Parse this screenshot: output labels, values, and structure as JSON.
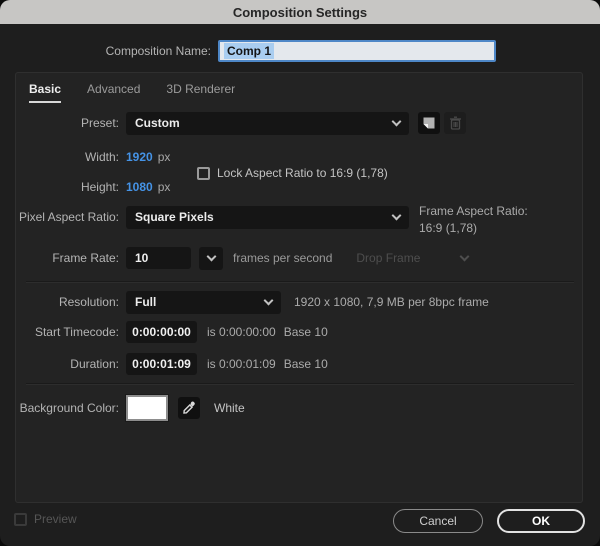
{
  "titlebar": {
    "title": "Composition Settings"
  },
  "name_row": {
    "label": "Composition Name:",
    "value": "Comp 1"
  },
  "tabs": {
    "items": [
      {
        "label": "Basic",
        "active": true
      },
      {
        "label": "Advanced",
        "active": false
      },
      {
        "label": "3D Renderer",
        "active": false
      }
    ]
  },
  "rows": {
    "preset": {
      "label": "Preset:",
      "value": "Custom",
      "save_icon": "save-preset-icon",
      "delete_icon": "trash-icon"
    },
    "width": {
      "label": "Width:",
      "value": "1920",
      "unit": "px"
    },
    "height": {
      "label": "Height:",
      "value": "1080",
      "unit": "px"
    },
    "lock_aspect": {
      "label": "Lock Aspect Ratio to 16:9 (1,78)",
      "checked": false
    },
    "pixel_aspect": {
      "label": "Pixel Aspect Ratio:",
      "value": "Square Pixels",
      "frame_aspect_label": "Frame Aspect Ratio:",
      "frame_aspect_value": "16:9 (1,78)"
    },
    "frame_rate": {
      "label": "Frame Rate:",
      "value": "10",
      "unit_text": "frames per second",
      "drop_frame_label": "Drop Frame",
      "drop_frame_enabled": false
    },
    "resolution": {
      "label": "Resolution:",
      "value": "Full",
      "info": "1920 x 1080, 7,9 MB per 8bpc frame"
    },
    "start_timecode": {
      "label": "Start Timecode:",
      "value": "0:00:00:00",
      "is_text": "is 0:00:00:00",
      "base_text": "Base 10"
    },
    "duration": {
      "label": "Duration:",
      "value": "0:00:01:09",
      "is_text": "is 0:00:01:09",
      "base_text": "Base 10"
    },
    "background": {
      "label": "Background Color:",
      "value_name": "White",
      "swatch_color": "#ffffff",
      "swatch_style": "background:#ffffff"
    }
  },
  "footer": {
    "preview_label": "Preview",
    "preview_enabled": false,
    "cancel_label": "Cancel",
    "ok_label": "OK"
  },
  "colors": {
    "accent_blue": "#4593e6",
    "titlebar_bg": "#c7c6c4",
    "panel_bg": "#232323",
    "dialog_bg": "#1e1e1e",
    "selection_bg": "#a9cdf0",
    "focus_border": "#4e87c7"
  }
}
